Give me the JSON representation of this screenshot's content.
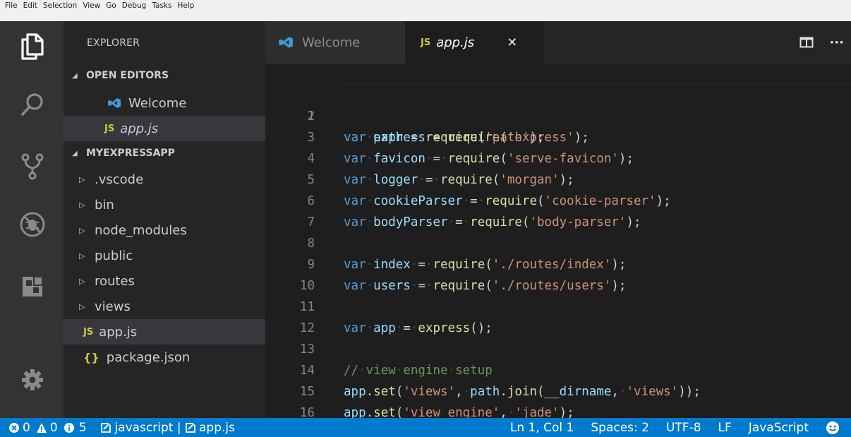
{
  "menu": [
    "File",
    "Edit",
    "Selection",
    "View",
    "Go",
    "Debug",
    "Tasks",
    "Help"
  ],
  "activity_icons": [
    "files-icon",
    "search-icon",
    "source-control-icon",
    "debug-icon",
    "extensions-icon",
    "settings-gear-icon"
  ],
  "sidebar": {
    "title": "EXPLORER",
    "open_editors_label": "OPEN EDITORS",
    "open_editors": [
      {
        "label": "Welcome",
        "icon": "vscode-icon"
      },
      {
        "label": "app.js",
        "icon": "js-icon",
        "italic": true,
        "active": true
      }
    ],
    "project_label": "MYEXPRESSAPP",
    "folders": [
      ".vscode",
      "bin",
      "node_modules",
      "public",
      "routes",
      "views"
    ],
    "files": [
      {
        "label": "app.js",
        "badge": "JS",
        "active": true
      },
      {
        "label": "package.json",
        "badge": "{}"
      }
    ]
  },
  "tabs": [
    {
      "label": "Welcome",
      "icon": "vscode-icon",
      "active": false
    },
    {
      "label": "app.js",
      "badge": "JS",
      "active": true,
      "close": "✕"
    }
  ],
  "editor": {
    "line_numbers": [
      "1",
      "2",
      "3",
      "4",
      "5",
      "6",
      "7",
      "8",
      "9",
      "10",
      "11",
      "12",
      "13",
      "14",
      "15",
      "16"
    ]
  },
  "status": {
    "errors": "0",
    "warnings": "0",
    "info": "5",
    "project": "javascript | ",
    "project_file": "app.js",
    "position": "Ln 1, Col 1",
    "spaces": "Spaces: 2",
    "encoding": "UTF-8",
    "eol": "LF",
    "language": "JavaScript"
  },
  "colors": {
    "status_bar": "#007acc",
    "activity_bar": "#333333",
    "sidebar": "#252526",
    "editor": "#1e1e1e",
    "keyword": "#569cd6",
    "string": "#ce9178",
    "function": "#dcdcaa",
    "variable": "#9cdcfe",
    "comment": "#6a9955"
  }
}
